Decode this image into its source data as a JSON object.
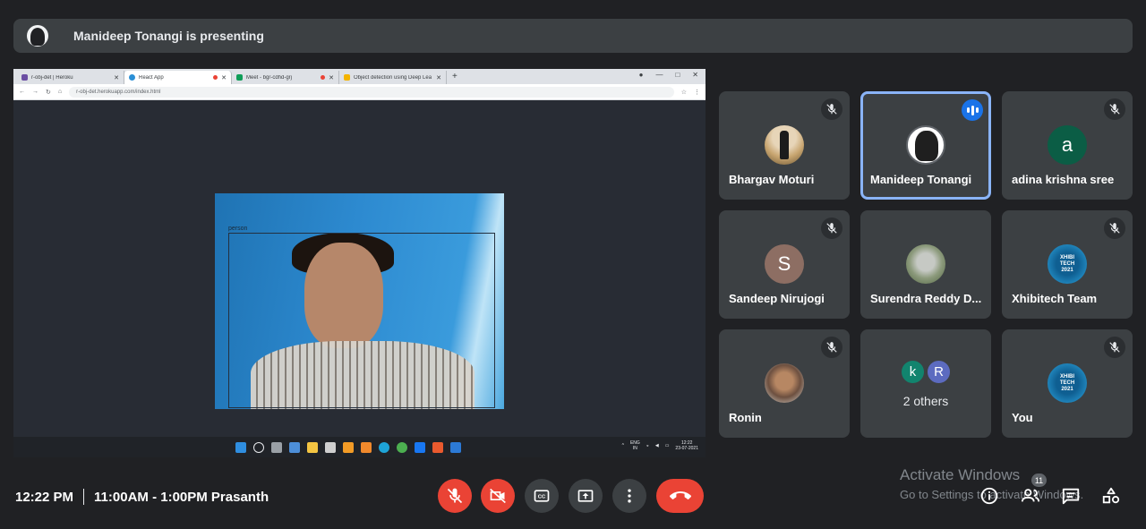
{
  "presenting": {
    "text": "Manideep Tonangi is presenting"
  },
  "shared_screen": {
    "tabs": [
      {
        "label": "r-obj-det | Heroku",
        "color": "#6b4ea3"
      },
      {
        "label": "React App",
        "color": "#2b8fd6"
      },
      {
        "label": "Meet - bgr-cdhd-grj",
        "color": "#0f9d58"
      },
      {
        "label": "Object detection using Deep Lea",
        "color": "#f4b400"
      }
    ],
    "url": "r-obj-det.herokuapp.com/index.html",
    "detection_label": "person",
    "taskbar": {
      "lang": "ENG",
      "region": "IN",
      "time": "12:22",
      "date": "23-07-2021"
    }
  },
  "participants": [
    {
      "name": "Bhargav Moturi",
      "avatar": "photo",
      "muted": true
    },
    {
      "name": "Manideep Tonangi",
      "avatar": "photo",
      "muted": false,
      "speaking": true
    },
    {
      "name": "adina krishna sree",
      "initial": "a",
      "avatar_color": "#0b5d45",
      "muted": true
    },
    {
      "name": "Sandeep Nirujogi",
      "initial": "S",
      "avatar_color": "#8d6e63",
      "muted": true
    },
    {
      "name": "Surendra Reddy D...",
      "avatar": "photo",
      "muted": false
    },
    {
      "name": "Xhibitech Team",
      "avatar": "logo",
      "muted": true
    },
    {
      "name": "Ronin",
      "avatar": "photo",
      "muted": true
    },
    {
      "others_label": "2 others",
      "initials": [
        "k",
        "R"
      ],
      "colors": [
        "#12846e",
        "#5c6bc0"
      ]
    },
    {
      "name": "You",
      "avatar": "logo",
      "muted": true
    }
  ],
  "logo_text": [
    "XHIBI",
    "TECH",
    "2021"
  ],
  "meeting": {
    "time": "12:22 PM",
    "details": "11:00AM - 1:00PM Prasanth"
  },
  "controls": {
    "mic": "mic-off-icon",
    "camera": "camera-off-icon",
    "captions": "captions-icon",
    "present": "present-icon",
    "more": "more-icon",
    "end": "end-call-icon"
  },
  "watermark": {
    "line1": "Activate Windows",
    "line2": "Go to Settings to activate Windows."
  },
  "participant_count": "11",
  "colors": {
    "background": "#202124",
    "tile": "#3c4043",
    "red": "#ea4335",
    "speaking": "#8ab4f8"
  }
}
